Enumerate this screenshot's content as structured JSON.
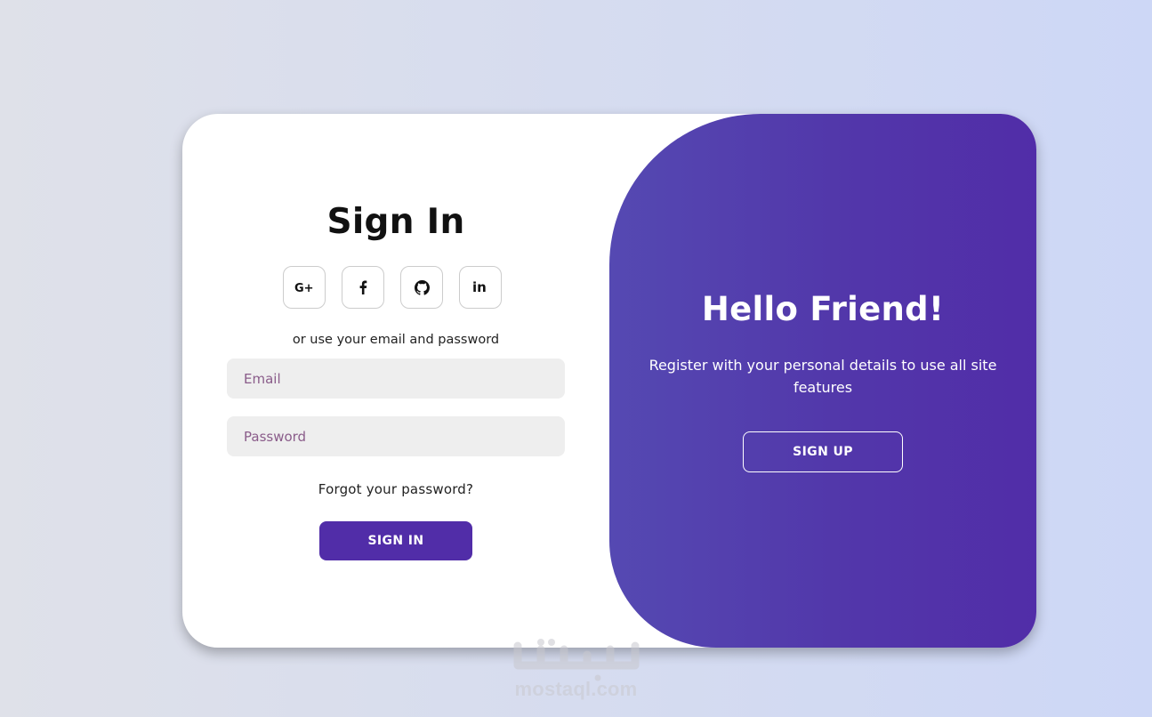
{
  "signin": {
    "title": "Sign In",
    "social_buttons": [
      {
        "label": "G+",
        "icon": "google-plus-icon"
      },
      {
        "label": "f",
        "icon": "facebook-icon"
      },
      {
        "label": "",
        "icon": "github-icon"
      },
      {
        "label": "in",
        "icon": "linkedin-icon"
      }
    ],
    "alt_text": "or use your email and password",
    "email_placeholder": "Email",
    "password_placeholder": "Password",
    "forgot_link": "Forgot your password?",
    "submit_label": "SIGN IN"
  },
  "toggle": {
    "title": "Hello Friend!",
    "text": "Register with your personal details to use all site features",
    "button_label": "SIGN UP"
  },
  "watermark": {
    "text": "mostaql.com"
  },
  "colors": {
    "primary": "#512da8",
    "gradient_start": "#5549b2",
    "input_bg": "#eeeeee",
    "placeholder": "#8a5c8a"
  }
}
